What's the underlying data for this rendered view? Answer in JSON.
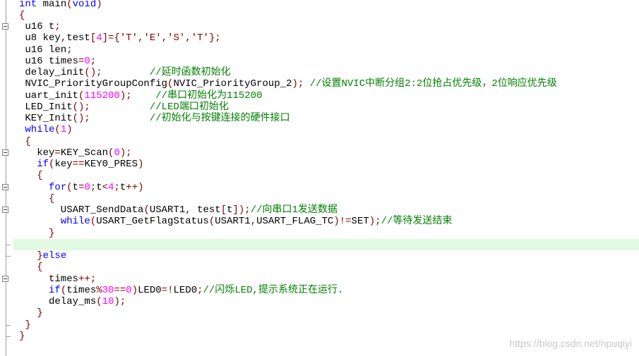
{
  "editor": {
    "highlight_line": 22,
    "highlight_color": "#e2f9e2",
    "colors": {
      "keyword": "#0000ff",
      "punctuation": "#800000",
      "number": "#ff00ff",
      "comment": "#008000"
    },
    "fold_lines": [
      2,
      13,
      16,
      18,
      24
    ],
    "lines": [
      [
        [
          "int",
          "kw"
        ],
        [
          " main",
          "t"
        ],
        [
          "(",
          "p"
        ],
        [
          "void",
          "kw"
        ],
        [
          ")",
          "p"
        ]
      ],
      [
        [
          "{",
          "p"
        ]
      ],
      [
        [
          " u16 t",
          "t"
        ],
        [
          ";",
          "p"
        ]
      ],
      [
        [
          " u8 key",
          "t"
        ],
        [
          ",",
          "p"
        ],
        [
          "test",
          "t"
        ],
        [
          "[",
          "p"
        ],
        [
          "4",
          "n"
        ],
        [
          "]={",
          "p"
        ],
        [
          "'T'",
          "p"
        ],
        [
          ",",
          "p"
        ],
        [
          "'E'",
          "p"
        ],
        [
          ",",
          "p"
        ],
        [
          "'S'",
          "p"
        ],
        [
          ",",
          "p"
        ],
        [
          "'T'",
          "p"
        ],
        [
          "};",
          "p"
        ]
      ],
      [
        [
          " u16 len",
          "t"
        ],
        [
          ";",
          "p"
        ]
      ],
      [
        [
          " u16 times",
          "t"
        ],
        [
          "=",
          "p"
        ],
        [
          "0",
          "n"
        ],
        [
          ";",
          "p"
        ]
      ],
      [
        [
          " delay_init",
          "t"
        ],
        [
          "();",
          "p"
        ],
        [
          "        ",
          "t"
        ],
        [
          "//延时函数初始化",
          "c"
        ]
      ],
      [
        [
          " NVIC_PriorityGroupConfig",
          "t"
        ],
        [
          "(",
          "p"
        ],
        [
          "NVIC_PriorityGroup_2",
          "t"
        ],
        [
          ");",
          "p"
        ],
        [
          " ",
          "t"
        ],
        [
          "//设置NVIC中断分组2:2位抢占优先级，2位响应优先级",
          "c"
        ]
      ],
      [
        [
          " uart_init",
          "t"
        ],
        [
          "(",
          "p"
        ],
        [
          "115200",
          "n"
        ],
        [
          ");",
          "p"
        ],
        [
          "    ",
          "t"
        ],
        [
          "//串口初始化为115200",
          "c"
        ]
      ],
      [
        [
          " LED_Init",
          "t"
        ],
        [
          "();",
          "p"
        ],
        [
          "          ",
          "t"
        ],
        [
          "//LED端口初始化",
          "c"
        ]
      ],
      [
        [
          " KEY_Init",
          "t"
        ],
        [
          "();",
          "p"
        ],
        [
          "          ",
          "t"
        ],
        [
          "//初始化与按键连接的硬件接口",
          "c"
        ]
      ],
      [
        [
          " ",
          "t"
        ],
        [
          "while",
          "kw"
        ],
        [
          "(",
          "p"
        ],
        [
          "1",
          "n"
        ],
        [
          ")",
          "p"
        ]
      ],
      [
        [
          " ",
          "t"
        ],
        [
          "{",
          "p"
        ]
      ],
      [
        [
          "   key",
          "t"
        ],
        [
          "=",
          "p"
        ],
        [
          "KEY_Scan",
          "t"
        ],
        [
          "(",
          "p"
        ],
        [
          "0",
          "n"
        ],
        [
          ");",
          "p"
        ]
      ],
      [
        [
          "   ",
          "t"
        ],
        [
          "if",
          "kw"
        ],
        [
          "(",
          "p"
        ],
        [
          "key",
          "t"
        ],
        [
          "==",
          "p"
        ],
        [
          "KEY0_PRES",
          "t"
        ],
        [
          ")",
          "p"
        ]
      ],
      [
        [
          "   ",
          "t"
        ],
        [
          "{",
          "p"
        ]
      ],
      [
        [
          "     ",
          "t"
        ],
        [
          "for",
          "kw"
        ],
        [
          "(",
          "p"
        ],
        [
          "t",
          "t"
        ],
        [
          "=",
          "p"
        ],
        [
          "0",
          "n"
        ],
        [
          ";",
          "p"
        ],
        [
          "t",
          "t"
        ],
        [
          "<",
          "p"
        ],
        [
          "4",
          "n"
        ],
        [
          ";",
          "p"
        ],
        [
          "t",
          "t"
        ],
        [
          "++)",
          "p"
        ]
      ],
      [
        [
          "     ",
          "t"
        ],
        [
          "{",
          "p"
        ]
      ],
      [
        [
          "       USART_SendData",
          "t"
        ],
        [
          "(",
          "p"
        ],
        [
          "USART1",
          "t"
        ],
        [
          ",",
          "p"
        ],
        [
          " test",
          "t"
        ],
        [
          "[",
          "p"
        ],
        [
          "t",
          "t"
        ],
        [
          "]);",
          "p"
        ],
        [
          "//向串口1发送数据",
          "c"
        ]
      ],
      [
        [
          "       ",
          "t"
        ],
        [
          "while",
          "kw"
        ],
        [
          "(",
          "p"
        ],
        [
          "USART_GetFlagStatus",
          "t"
        ],
        [
          "(",
          "p"
        ],
        [
          "USART1",
          "t"
        ],
        [
          ",",
          "p"
        ],
        [
          "USART_FLAG_TC",
          "t"
        ],
        [
          ")!=",
          "p"
        ],
        [
          "SET",
          "t"
        ],
        [
          ");",
          "p"
        ],
        [
          "//等待发送结束",
          "c"
        ]
      ],
      [
        [
          "     ",
          "t"
        ],
        [
          "}",
          "p"
        ]
      ],
      [
        [
          "",
          "t"
        ]
      ],
      [
        [
          "   ",
          "t"
        ],
        [
          "}",
          "p"
        ],
        [
          "else",
          "kw"
        ]
      ],
      [
        [
          "   ",
          "t"
        ],
        [
          "{",
          "p"
        ]
      ],
      [
        [
          "     times",
          "t"
        ],
        [
          "++;",
          "p"
        ]
      ],
      [
        [
          "     ",
          "t"
        ],
        [
          "if",
          "kw"
        ],
        [
          "(",
          "p"
        ],
        [
          "times",
          "t"
        ],
        [
          "%",
          "p"
        ],
        [
          "30",
          "n"
        ],
        [
          "==",
          "p"
        ],
        [
          "0",
          "n"
        ],
        [
          ")",
          "p"
        ],
        [
          "LED0",
          "t"
        ],
        [
          "=!",
          "p"
        ],
        [
          "LED0",
          "t"
        ],
        [
          ";",
          "p"
        ],
        [
          "//闪烁LED,提示系统正在运行.",
          "c"
        ]
      ],
      [
        [
          "     delay_ms",
          "t"
        ],
        [
          "(",
          "p"
        ],
        [
          "10",
          "n"
        ],
        [
          ");",
          "p"
        ]
      ],
      [
        [
          "   ",
          "t"
        ],
        [
          "}",
          "p"
        ]
      ],
      [
        [
          " ",
          "t"
        ],
        [
          "}",
          "p"
        ]
      ],
      [
        [
          "}",
          "p"
        ]
      ]
    ]
  },
  "watermark": "https://blog.csdn.net/npuqiyi"
}
